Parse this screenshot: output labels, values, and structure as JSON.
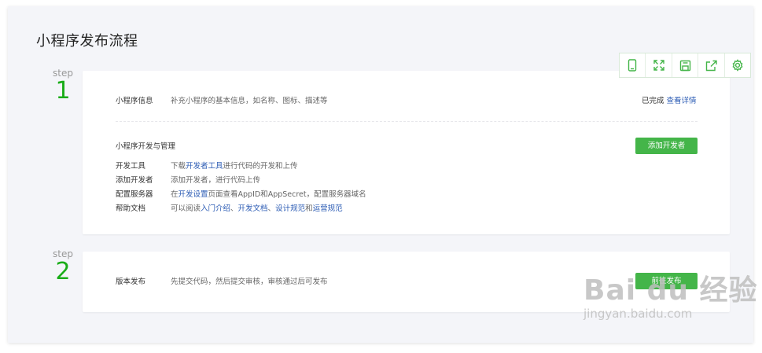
{
  "page": {
    "title": "小程序发布流程"
  },
  "step1": {
    "label": "step",
    "number": "1",
    "info": {
      "label": "小程序信息",
      "desc": "补充小程序的基本信息，如名称、图标、描述等",
      "status": "已完成",
      "link": "查看详情"
    },
    "dev": {
      "title": "小程序开发与管理",
      "button": "添加开发者",
      "rows": [
        {
          "label": "开发工具",
          "parts": [
            "下载",
            "开发者工具",
            "进行代码的开发和上传"
          ]
        },
        {
          "label": "添加开发者",
          "parts": [
            "添加开发者，进行代码上传"
          ]
        },
        {
          "label": "配置服务器",
          "parts": [
            "在",
            "开发设置",
            "页面查看AppID和AppSecret，配置服务器域名"
          ]
        },
        {
          "label": "帮助文档",
          "parts": [
            "可以阅读",
            "入门介绍",
            "、",
            "开发文档",
            "、",
            "设计规范",
            "和",
            "运营规范"
          ]
        }
      ]
    }
  },
  "step2": {
    "label": "step",
    "number": "2",
    "release": {
      "label": "版本发布",
      "desc": "先提交代码，然后提交审核，审核通过后可发布",
      "button": "前往发布"
    }
  },
  "toolbar": {
    "icons": [
      "phone-icon",
      "fullscreen-icon",
      "save-icon",
      "share-icon",
      "gear-icon"
    ]
  },
  "watermark": {
    "main": "Bai du 经验",
    "sub": "jingyan.baidu.com"
  },
  "colors": {
    "accent": "#1aad19",
    "button": "#44b549",
    "link": "#2b5bb4"
  }
}
